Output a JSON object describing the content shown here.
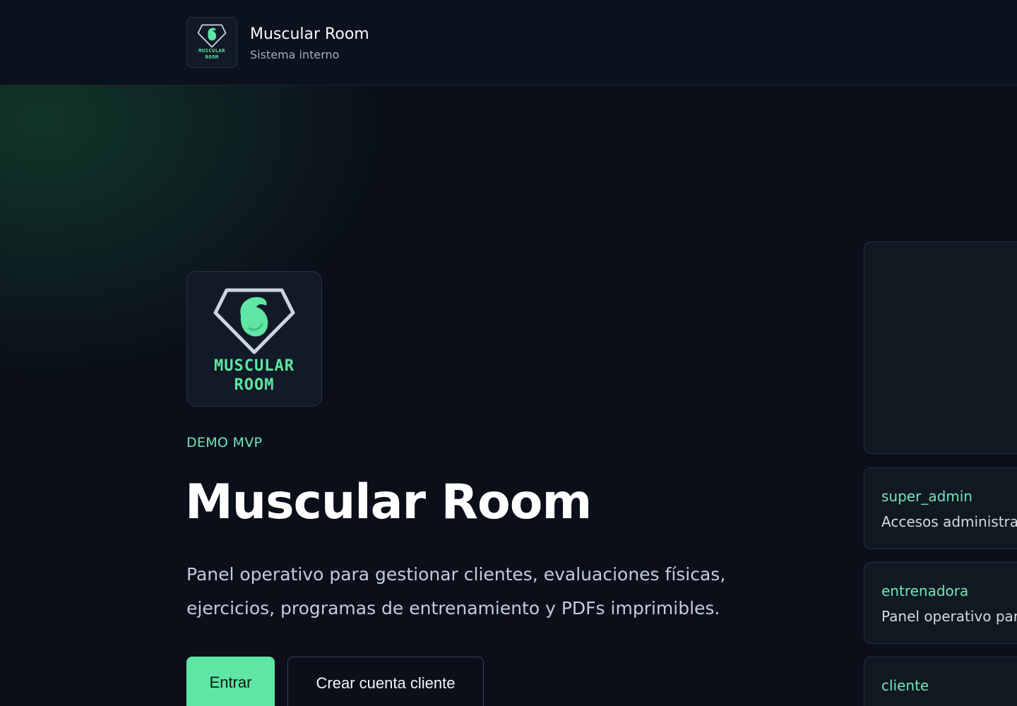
{
  "header": {
    "logo_text_line1": "MUSCULAR",
    "logo_text_line2": "ROOM",
    "title": "Muscular Room",
    "subtitle": "Sistema interno"
  },
  "hero": {
    "logo_text_line1": "MUSCULAR",
    "logo_text_line2": "ROOM",
    "eyebrow": "DEMO MVP",
    "title": "Muscular Room",
    "description": "Panel operativo para gestionar clientes, evaluaciones físicas, ejercicios, programas de entrenamiento y PDFs imprimibles.",
    "primary_button": "Entrar",
    "secondary_button": "Crear cuenta cliente"
  },
  "roles": [
    {
      "name": "super_admin",
      "description": "Accesos administrativ"
    },
    {
      "name": "entrenadora",
      "description": "Panel operativo para"
    },
    {
      "name": "cliente",
      "description": ""
    }
  ],
  "colors": {
    "accent": "#5ee6a4",
    "background": "#0a0f1a",
    "card": "#111821"
  }
}
